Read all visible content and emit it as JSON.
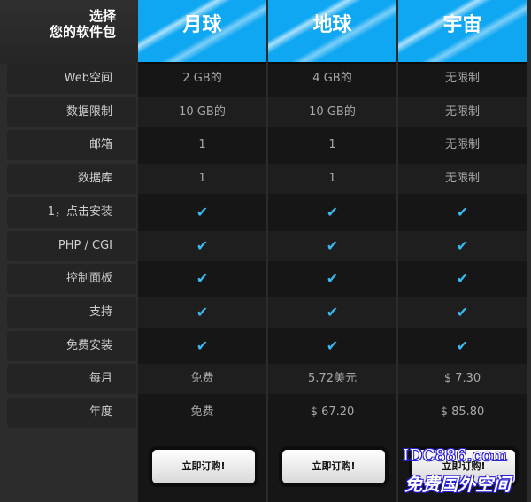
{
  "corner": {
    "line1": "选择",
    "line2": "您的软件包"
  },
  "plans": [
    {
      "name": "月球"
    },
    {
      "name": "地球"
    },
    {
      "name": "宇宙"
    }
  ],
  "features": [
    {
      "label": "Web空间",
      "values": [
        "2 GB的",
        "4 GB的",
        "无限制"
      ]
    },
    {
      "label": "数据限制",
      "values": [
        "10 GB的",
        "10 GB的",
        "无限制"
      ]
    },
    {
      "label": "邮箱",
      "values": [
        "1",
        "1",
        "无限制"
      ]
    },
    {
      "label": "数据库",
      "values": [
        "1",
        "1",
        "无限制"
      ]
    },
    {
      "label": "1，点击安装",
      "values": [
        "✔",
        "✔",
        "✔"
      ]
    },
    {
      "label": "PHP / CGI",
      "values": [
        "✔",
        "✔",
        "✔"
      ]
    },
    {
      "label": "控制面板",
      "values": [
        "✔",
        "✔",
        "✔"
      ]
    },
    {
      "label": "支持",
      "values": [
        "✔",
        "✔",
        "✔"
      ]
    },
    {
      "label": "免费安装",
      "values": [
        "✔",
        "✔",
        "✔"
      ]
    },
    {
      "label": "每月",
      "values": [
        "免费",
        "5.72美元",
        "$ 7.30"
      ]
    },
    {
      "label": "年度",
      "values": [
        "免费",
        "$ 67.20",
        "$ 85.80"
      ]
    }
  ],
  "buttons": {
    "order_label": "立即订购!"
  },
  "watermark": {
    "line1": "IDC886.com",
    "line2": "免费国外空间"
  },
  "colors": {
    "header_blue": "#10a7f2",
    "check_blue": "#3bb9ef"
  }
}
